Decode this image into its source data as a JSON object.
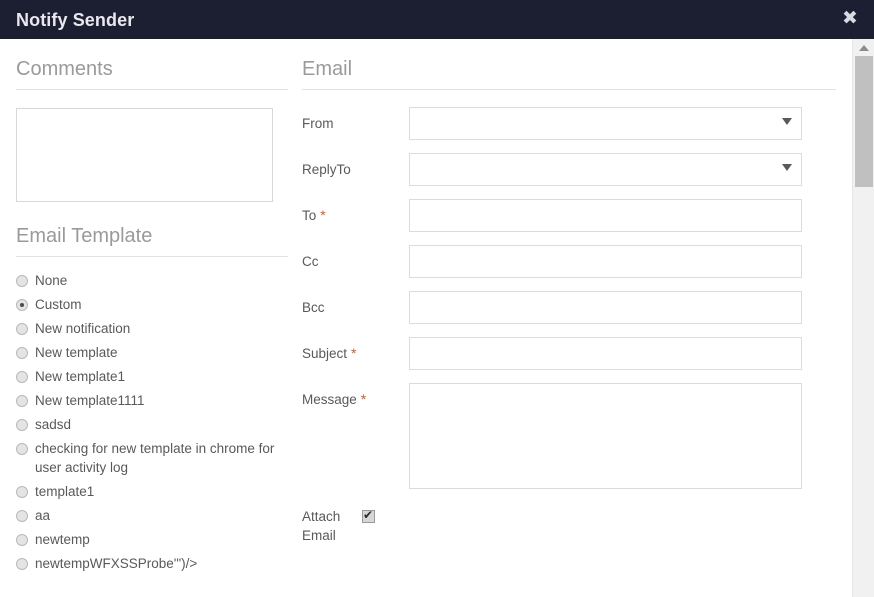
{
  "window": {
    "title": "Notify Sender",
    "close_icon": "close-icon",
    "header_bg": "#1c1e32",
    "header_text_color": "#e8e8ee"
  },
  "comments": {
    "heading": "Comments",
    "textarea_value": "",
    "textarea_placeholder": ""
  },
  "email_template": {
    "heading": "Email Template",
    "selected": "Custom",
    "options": [
      {
        "label": "None",
        "checked": false
      },
      {
        "label": "Custom",
        "checked": true
      },
      {
        "label": "New notification",
        "checked": false
      },
      {
        "label": "New template",
        "checked": false
      },
      {
        "label": "New template1",
        "checked": false
      },
      {
        "label": "New template1111",
        "checked": false
      },
      {
        "label": "sadsd",
        "checked": false
      },
      {
        "label": "checking for new template in chrome for user activity log",
        "checked": false
      },
      {
        "label": "template1",
        "checked": false
      },
      {
        "label": "aa",
        "checked": false
      },
      {
        "label": "newtemp",
        "checked": false
      },
      {
        "label": "newtempWFXSSProbe'\")/>",
        "checked": false
      }
    ]
  },
  "email": {
    "heading": "Email",
    "required_marker": "*",
    "required_color": "#e2591f",
    "fields": {
      "from": {
        "label": "From",
        "type": "select",
        "value": "",
        "required": false
      },
      "reply_to": {
        "label": "ReplyTo",
        "type": "select",
        "value": "",
        "required": false
      },
      "to": {
        "label": "To",
        "type": "text",
        "value": "",
        "placeholder": "",
        "required": true
      },
      "cc": {
        "label": "Cc",
        "type": "text",
        "value": "",
        "placeholder": "",
        "required": false
      },
      "bcc": {
        "label": "Bcc",
        "type": "text",
        "value": "",
        "placeholder": "",
        "required": false
      },
      "subject": {
        "label": "Subject",
        "type": "text",
        "value": "",
        "placeholder": "",
        "required": true
      },
      "message": {
        "label": "Message",
        "type": "textarea",
        "value": "",
        "placeholder": "",
        "required": true
      },
      "attach_email": {
        "label_line1": "Attach",
        "label_line2": "Email",
        "type": "checkbox",
        "checked": true
      }
    }
  },
  "scrollbar": {
    "up_arrow_icon": "chevron-up-icon",
    "thumb_position_percent": 0
  }
}
